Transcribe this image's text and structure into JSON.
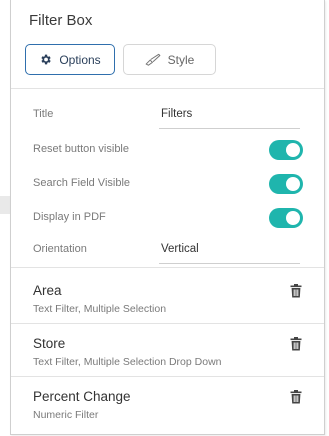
{
  "panel": {
    "title": "Filter Box"
  },
  "tabs": [
    {
      "label": "Options",
      "icon": "gear-icon",
      "active": true
    },
    {
      "label": "Style",
      "icon": "paintbrush-icon",
      "active": false
    }
  ],
  "properties": {
    "title": {
      "label": "Title",
      "value": "Filters"
    },
    "reset_button": {
      "label": "Reset button visible",
      "on": true
    },
    "search_field": {
      "label": "Search Field Visible",
      "on": true
    },
    "display_pdf": {
      "label": "Display in PDF",
      "on": true
    },
    "orientation": {
      "label": "Orientation",
      "value": "Vertical"
    }
  },
  "filters": [
    {
      "name": "Area",
      "description": "Text Filter, Multiple Selection",
      "icon": "trash-icon"
    },
    {
      "name": "Store",
      "description": "Text Filter, Multiple Selection Drop Down",
      "icon": "trash-icon"
    },
    {
      "name": "Percent Change",
      "description": "Numeric Filter",
      "icon": "trash-icon"
    }
  ],
  "colors": {
    "accent": "#1fb5ad",
    "tab_border": "#2f6fad",
    "icon_dark": "#2a3f5a"
  }
}
